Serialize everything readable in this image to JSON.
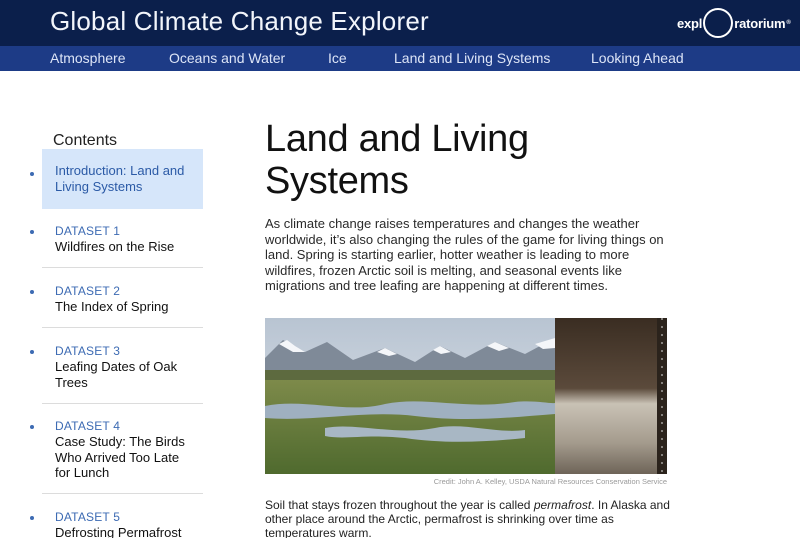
{
  "header": {
    "site_title": "Global Climate Change Explorer",
    "logo": {
      "left": "expl",
      "right": "ratorium",
      "reg": "®"
    }
  },
  "nav": {
    "items": [
      {
        "label": "Atmosphere"
      },
      {
        "label": "Oceans and Water"
      },
      {
        "label": "Ice"
      },
      {
        "label": "Land and Living Systems"
      },
      {
        "label": "Looking Ahead"
      }
    ]
  },
  "sidebar": {
    "title": "Contents",
    "items": [
      {
        "kicker": "",
        "text": "Introduction: Land and Living Systems",
        "active": true
      },
      {
        "kicker": "DATASET 1",
        "text": "Wildfires on the Rise"
      },
      {
        "kicker": "DATASET 2",
        "text": "The Index of Spring"
      },
      {
        "kicker": "DATASET 3",
        "text": "Leafing Dates of Oak Trees"
      },
      {
        "kicker": "DATASET 4",
        "text": "Case Study: The Birds Who Arrived Too Late for Lunch"
      },
      {
        "kicker": "DATASET 5",
        "text": "Defrosting Permafrost"
      }
    ]
  },
  "main": {
    "title": "Land and Living Systems",
    "intro": "As climate change raises temperatures and changes the weather worldwide, it’s also changing the rules of the game for living things on land. Spring is starting earlier, hotter weather is leading to more wildfires, frozen Arctic soil is melting, and seasonal events like migrations and tree leafing are happening at different times.",
    "photo_credit": "Credit: John A. Kelley, USDA Natural Resources Conservation Service",
    "caption": {
      "before": "Soil that stays frozen throughout the year is called ",
      "term": "permafrost",
      "after": ". In Alaska and other place around the Arctic, permafrost is shrinking over time as temperatures warm."
    }
  },
  "colors": {
    "header_bg": "#0b1f4b",
    "nav_bg": "#1d3b86",
    "accent": "#3d6bb3",
    "active_bg": "#d6e6fa"
  }
}
